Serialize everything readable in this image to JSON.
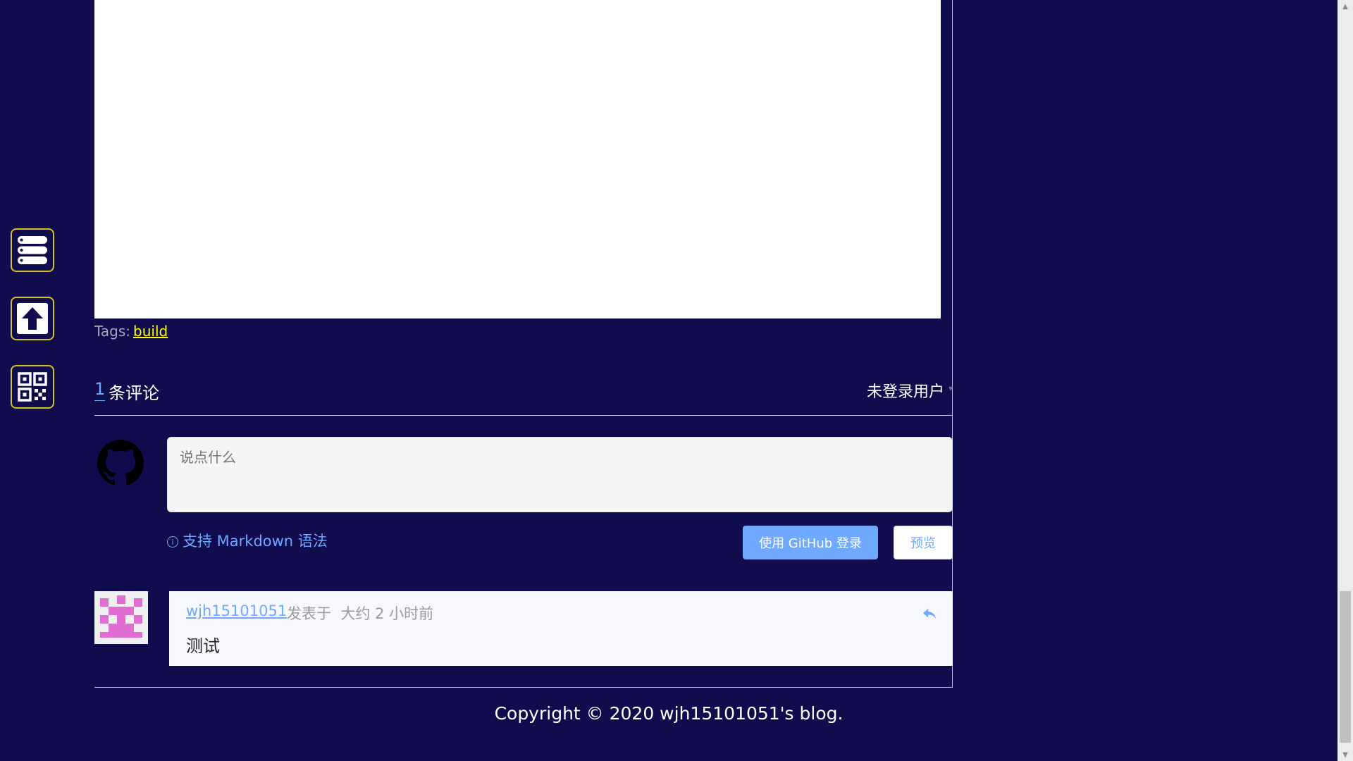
{
  "post": {
    "tags_label": "Tags:",
    "tag": "build"
  },
  "comments": {
    "count": "1",
    "count_label": "条评论",
    "user_status": "未登录用户",
    "input_placeholder": "说点什么",
    "markdown_hint": "支持 Markdown 语法",
    "login_button": "使用 GitHub 登录",
    "preview_button": "预览",
    "items": [
      {
        "author": "wjh15101051",
        "posted_label": "发表于",
        "time": "大约 2 小时前",
        "text": "测试"
      }
    ]
  },
  "sidebar": {
    "icons": [
      "menu-icon",
      "scroll-top-icon",
      "qr-code-icon"
    ]
  },
  "footer": {
    "copyright": "Copyright © 2020 wjh15101051's blog."
  },
  "colors": {
    "background": "#100c4d",
    "accent": "#6ea8ff",
    "border": "#d4c21e",
    "tag": "#ffff00"
  }
}
